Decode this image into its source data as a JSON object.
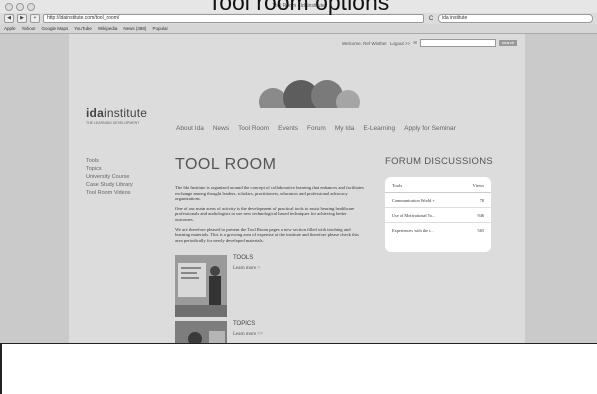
{
  "slide": {
    "title": "Tool room options"
  },
  "browser": {
    "window_title": "Tool Room - Idainstitute",
    "url": "http://idainstitute.com/tool_room/",
    "search_value": "ida institute",
    "back": "◀",
    "forward": "▶",
    "add": "+",
    "reload": "C",
    "bookmarks": [
      "Apple",
      "Yahoo!",
      "Google Maps",
      "YouTube",
      "Wikipedia",
      "News (388)",
      "Popular"
    ]
  },
  "site": {
    "welcome": "Welcome, Ref Winther",
    "logout": "Logout >>",
    "search_button": "search",
    "logo_bold": "ida",
    "logo_rest": "institute",
    "tagline": "THE LEARNING DEVELOPMENT",
    "nav": [
      "About Ida",
      "News",
      "Tool Room",
      "Events",
      "Forum",
      "My Ida",
      "E-Learning",
      "Apply for Seminar"
    ],
    "sidenav": [
      "Tools",
      "Topics",
      "University Course",
      "Case Study Library",
      "Tool Room Videos"
    ],
    "main_title": "TOOL ROOM",
    "paragraphs": [
      "The Ida Institute is organized around the concept of collaborative learning that enhances and facilitates exchange among thought leaders, scholars, practitioners, educators and professional advocacy organizations.",
      "One of our main areas of activity is the development of practical tools to assist hearing healthcare professionals and audiologists to use new technological based techniques for achieving better outcomes.",
      "We are therefore pleased to present the Tool Room pages a new section filled with teaching and learning materials. This is a growing area of expertise at the institute and therefore please check this area periodically for newly developed materials."
    ],
    "sections": [
      {
        "label": "TOOLS",
        "link": "Learn more >"
      },
      {
        "label": "TOPICS",
        "link": "Learn more >>"
      }
    ],
    "forum": {
      "title": "FORUM DISCUSSIONS",
      "col_topic": "Tools",
      "col_views": "Views",
      "rows": [
        {
          "topic": "Communication World +",
          "views": "78"
        },
        {
          "topic": "Use of Motivational To...",
          "views": "946"
        },
        {
          "topic": "Experiences with the t...",
          "views": "565"
        }
      ]
    }
  }
}
